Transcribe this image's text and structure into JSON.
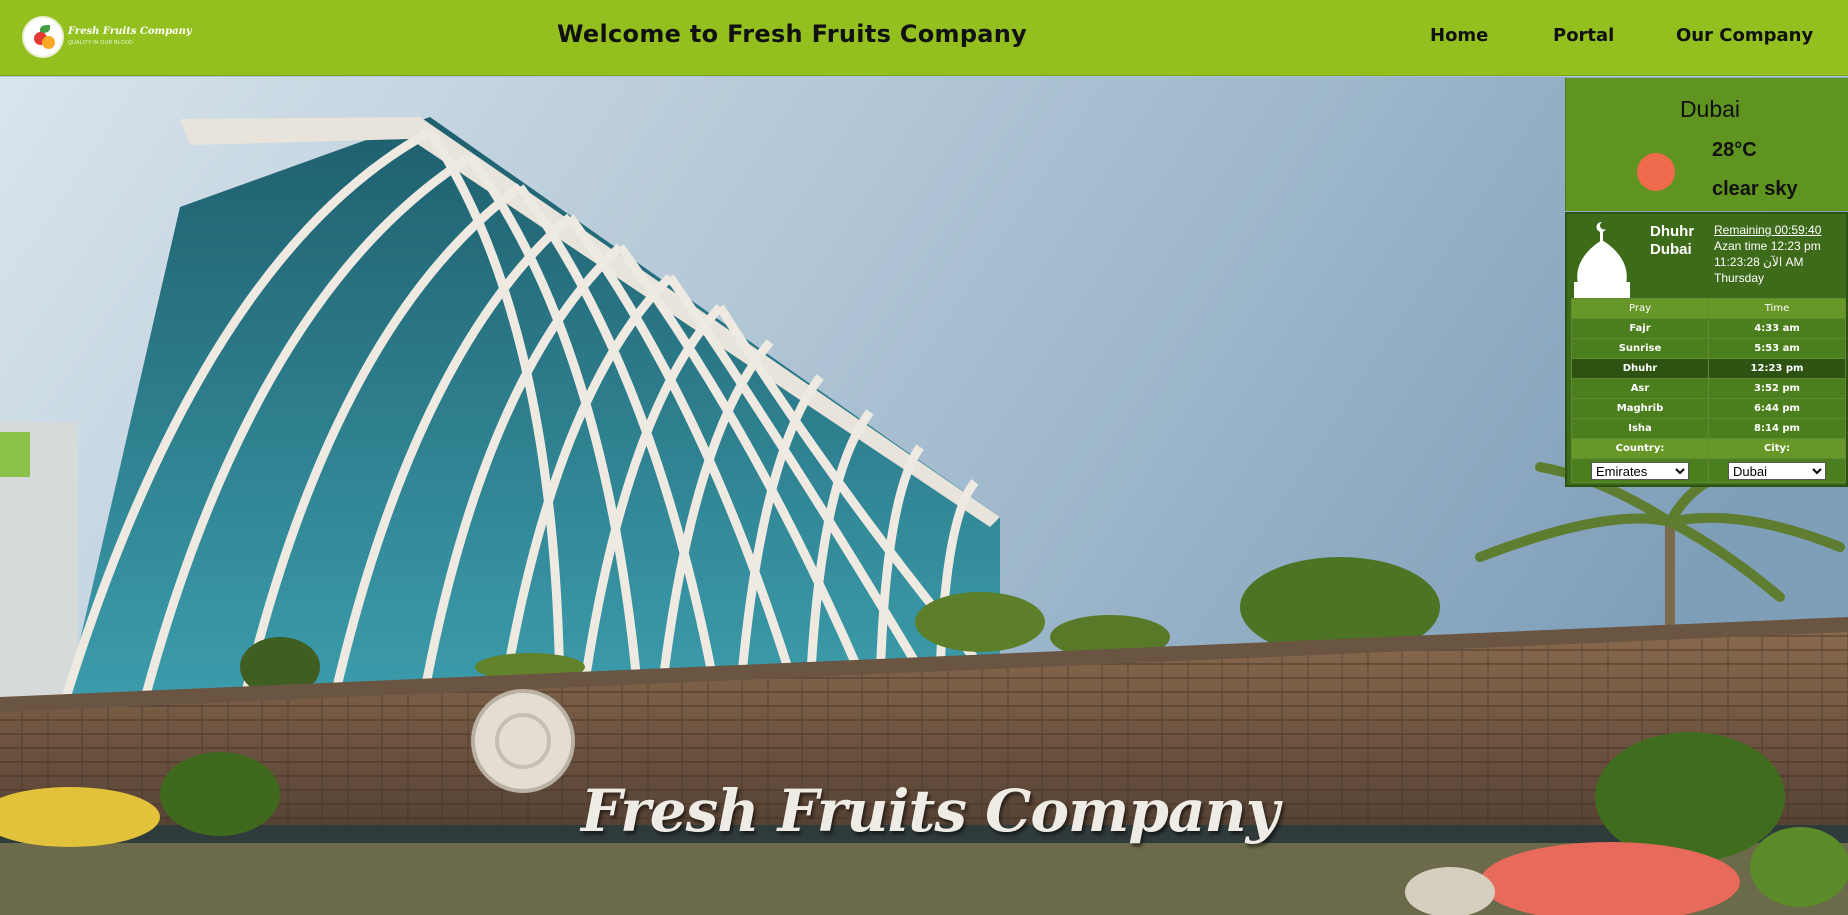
{
  "header": {
    "logo_name": "Fresh Fruits Company",
    "logo_tagline": "QUALITY IN OUR BLOOD",
    "title": "Welcome to Fresh Fruits Company",
    "nav": [
      {
        "label": "Home"
      },
      {
        "label": "Portal"
      },
      {
        "label": "Our Company"
      }
    ]
  },
  "hero": {
    "sign_text": "Fresh Fruits Company"
  },
  "weather": {
    "city": "Dubai",
    "temperature": "28°C",
    "description": "clear sky",
    "sun_color": "#ef6b4e"
  },
  "prayer": {
    "current_prayer": "Dhuhr",
    "city": "Dubai",
    "remaining": "Remaining 00:59:40",
    "azan_time": "Azan time 12:23 pm",
    "now": "11:23:28 الآن AM",
    "day": "Thursday",
    "table_headers": [
      "Pray",
      "Time"
    ],
    "rows": [
      {
        "name": "Fajr",
        "time": "4:33 am"
      },
      {
        "name": "Sunrise",
        "time": "5:53 am"
      },
      {
        "name": "Dhuhr",
        "time": "12:23 pm"
      },
      {
        "name": "Asr",
        "time": "3:52 pm"
      },
      {
        "name": "Maghrib",
        "time": "6:44 pm"
      },
      {
        "name": "Isha",
        "time": "8:14 pm"
      }
    ],
    "country_label": "Country:",
    "city_label": "City:",
    "country_selected": "Emirates",
    "city_selected": "Dubai"
  },
  "colors": {
    "header_bg": "#93c01f",
    "weather_bg": "#5f9420",
    "prayer_bg": "#3e6b1a"
  }
}
